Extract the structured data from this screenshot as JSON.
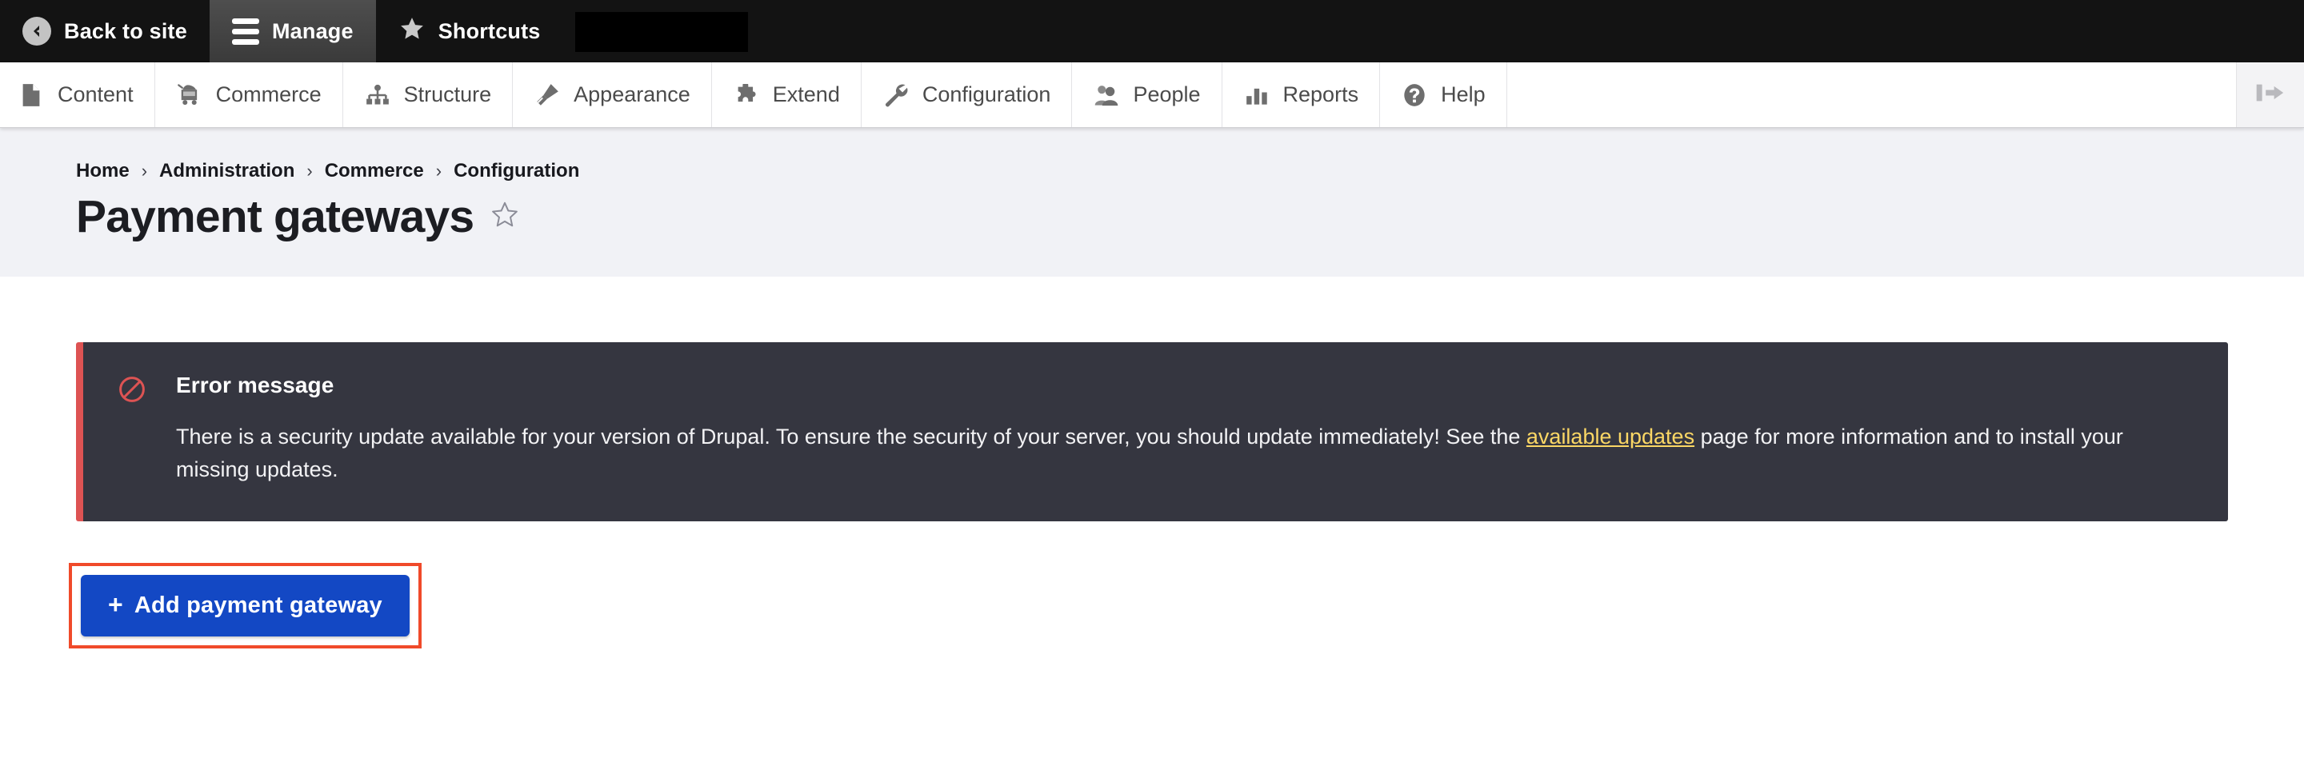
{
  "toolbar_top": {
    "tabs": [
      {
        "label": "Back to site",
        "icon": "back-circle-icon",
        "active": false
      },
      {
        "label": "Manage",
        "icon": "hamburger-icon",
        "active": true
      },
      {
        "label": "Shortcuts",
        "icon": "star-filled-icon",
        "active": false
      }
    ],
    "redacted_field": ""
  },
  "toolbar_menu": {
    "items": [
      {
        "label": "Content",
        "icon": "document-icon"
      },
      {
        "label": "Commerce",
        "icon": "shopping-cart-icon"
      },
      {
        "label": "Structure",
        "icon": "sitemap-icon"
      },
      {
        "label": "Appearance",
        "icon": "paintbrush-icon"
      },
      {
        "label": "Extend",
        "icon": "puzzle-piece-icon"
      },
      {
        "label": "Configuration",
        "icon": "wrench-icon"
      },
      {
        "label": "People",
        "icon": "people-icon"
      },
      {
        "label": "Reports",
        "icon": "bar-chart-icon"
      },
      {
        "label": "Help",
        "icon": "question-mark-icon"
      }
    ],
    "collapse_icon": "collapse-toolbar-icon"
  },
  "header": {
    "breadcrumb": [
      {
        "label": "Home"
      },
      {
        "label": "Administration"
      },
      {
        "label": "Commerce"
      },
      {
        "label": "Configuration"
      }
    ],
    "breadcrumb_separator": "›",
    "title": "Payment gateways",
    "favorite_icon": "star-outline-icon"
  },
  "message": {
    "type": "error",
    "icon": "error-circle-slash-icon",
    "title": "Error message",
    "text_before_link": "There is a security update available for your version of Drupal. To ensure the security of your server, you should update immediately! See the ",
    "link_label": "available updates",
    "text_after_link": " page for more information and to install your missing updates.",
    "accent_color": "#dd5353",
    "background_color": "#353640",
    "link_color": "#fbd765"
  },
  "actions": {
    "add_gateway_label": "Add payment gateway",
    "add_gateway_plus": "+",
    "button_color": "#1348c4",
    "highlight_color": "#f04a2a"
  }
}
